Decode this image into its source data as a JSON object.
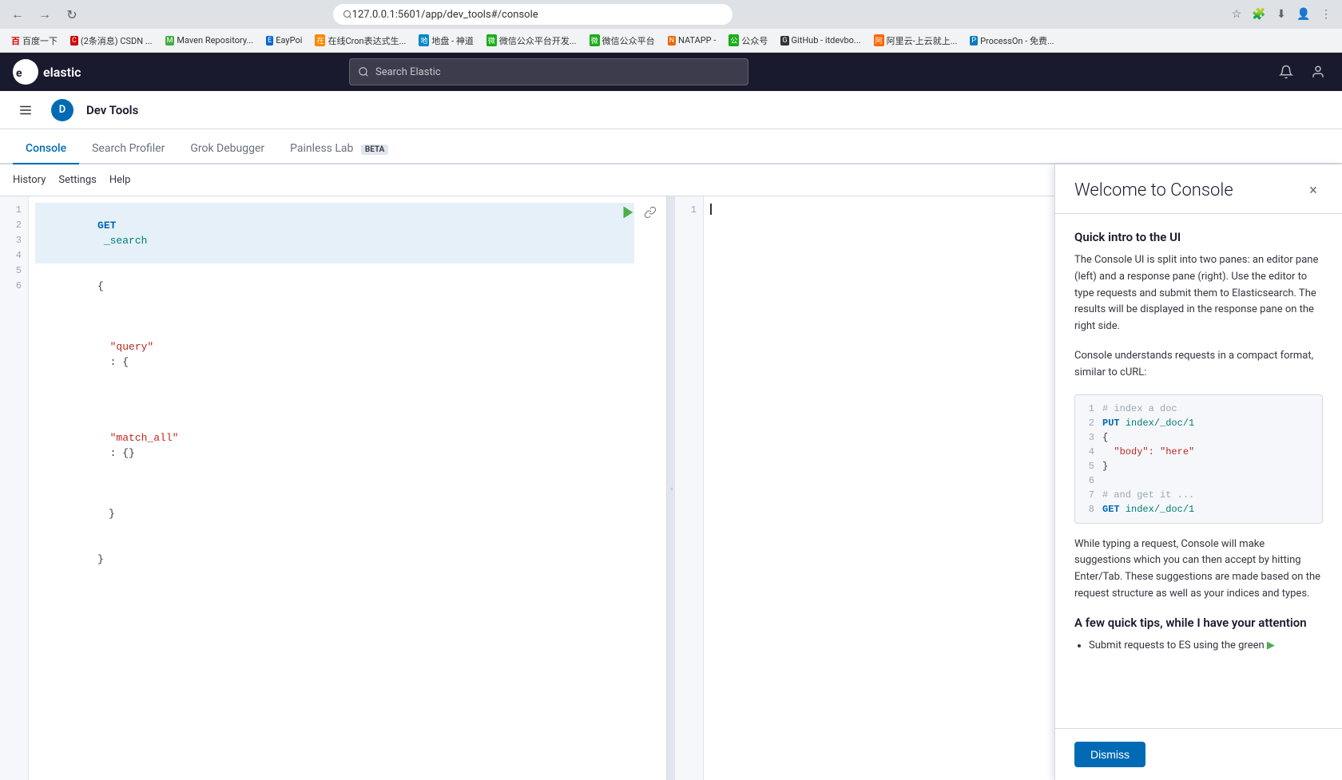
{
  "browser": {
    "url": "127.0.0.1:5601/app/dev_tools#/console",
    "back_icon": "←",
    "forward_icon": "→",
    "refresh_icon": "↻",
    "bookmarks": [
      {
        "label": "百度一下",
        "color": "#d00"
      },
      {
        "label": "(2条消息) CSDN..."
      },
      {
        "label": "Maven Repository..."
      },
      {
        "label": "EayPoi"
      },
      {
        "label": "在线Cron表达式生..."
      },
      {
        "label": "地盘 - 神道"
      },
      {
        "label": "微信公众平台开发..."
      },
      {
        "label": "微信公众平台"
      },
      {
        "label": "NATAPP -"
      },
      {
        "label": "公众号"
      },
      {
        "label": "GitHub - itdevbo..."
      },
      {
        "label": "阿里云-上云就上..."
      },
      {
        "label": "ProcessOn - 免费..."
      }
    ]
  },
  "kibana": {
    "logo_text": "elastic",
    "search_placeholder": "Search Elastic",
    "nav_title": "Dev Tools",
    "nav_avatar": "D"
  },
  "tabs": [
    {
      "label": "Console",
      "active": true
    },
    {
      "label": "Search Profiler",
      "active": false
    },
    {
      "label": "Grok Debugger",
      "active": false
    },
    {
      "label": "Painless Lab",
      "active": false,
      "badge": "BETA"
    }
  ],
  "toolbar": [
    {
      "label": "History"
    },
    {
      "label": "Settings"
    },
    {
      "label": "Help"
    }
  ],
  "editor": {
    "lines": [
      {
        "num": 1,
        "content": "GET _search",
        "highlight": true
      },
      {
        "num": 2,
        "content": "{"
      },
      {
        "num": 3,
        "content": "  \"query\": {"
      },
      {
        "num": 4,
        "content": "    \"match_all\": {}"
      },
      {
        "num": 5,
        "content": "  }"
      },
      {
        "num": 6,
        "content": "}"
      }
    ]
  },
  "response": {
    "lines": [
      {
        "num": 1,
        "content": ""
      }
    ]
  },
  "welcome": {
    "title": "Welcome to Console",
    "close_icon": "×",
    "sections": [
      {
        "heading": "Quick intro to the UI",
        "text": "The Console UI is split into two panes: an editor pane (left) and a response pane (right). Use the editor to type requests and submit them to Elasticsearch. The results will be displayed in the response pane on the right side.",
        "text2": "Console understands requests in a compact format, similar to cURL:"
      }
    ],
    "code_snippet": [
      {
        "num": 1,
        "code": "# index a doc",
        "type": "comment"
      },
      {
        "num": 2,
        "code": "PUT index/_doc/1",
        "type": "method"
      },
      {
        "num": 3,
        "code": "{",
        "type": "normal"
      },
      {
        "num": 4,
        "code": "  \"body\": \"here\"",
        "type": "string"
      },
      {
        "num": 5,
        "code": "}",
        "type": "normal"
      },
      {
        "num": 6,
        "code": "",
        "type": "normal"
      },
      {
        "num": 7,
        "code": "# and get it ...",
        "type": "comment"
      },
      {
        "num": 8,
        "code": "GET index/_doc/1",
        "type": "method"
      }
    ],
    "suggestion_text": "While typing a request, Console will make suggestions which you can then accept by hitting Enter/Tab. These suggestions are made based on the request structure as well as your indices and types.",
    "tips_heading": "A few quick tips, while I have your attention",
    "tip_text": "Submit requests to ES using the green",
    "dismiss_label": "Dismiss"
  }
}
